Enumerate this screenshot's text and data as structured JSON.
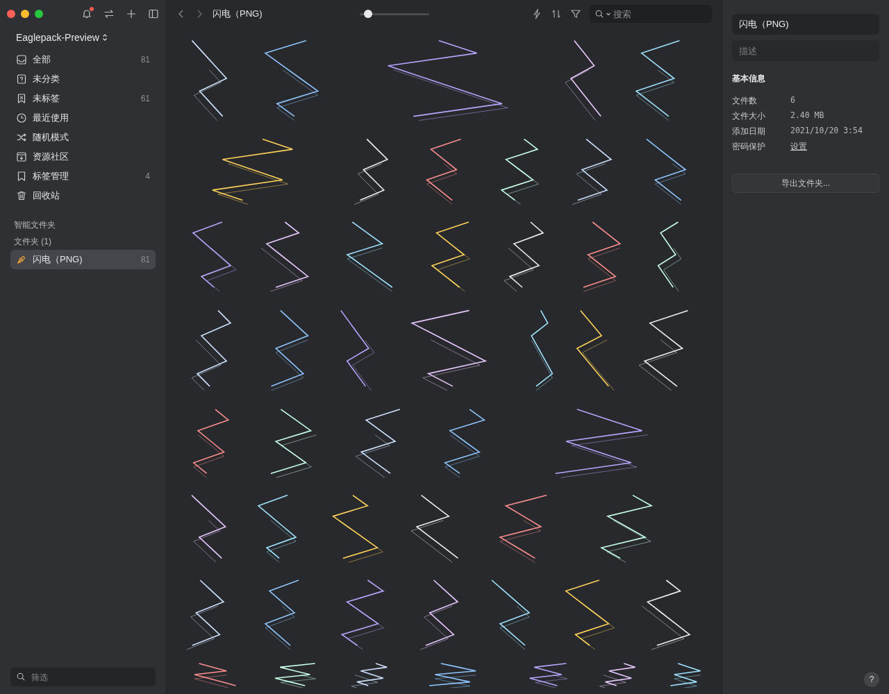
{
  "sidebar": {
    "library": "Eaglepack-Preview",
    "items": [
      {
        "kind": "inbox",
        "label": "全部",
        "count": "81",
        "selected": false
      },
      {
        "kind": "question",
        "label": "未分类",
        "selected": false
      },
      {
        "kind": "untagged",
        "label": "未标签",
        "count": "61",
        "selected": false
      },
      {
        "kind": "clock",
        "label": "最近使用",
        "selected": false
      },
      {
        "kind": "shuffle",
        "label": "随机模式",
        "selected": false
      },
      {
        "kind": "archive",
        "label": "资源社区",
        "selected": false
      },
      {
        "kind": "bookmark",
        "label": "标签管理",
        "count": "4",
        "selected": false
      },
      {
        "kind": "trash",
        "label": "回收站",
        "selected": false
      }
    ],
    "smart_folders": "智能文件夹",
    "folders_heading": "文件夹 (1)",
    "folders": [
      {
        "label": "闪电（PNG)",
        "count": "81",
        "selected": true
      }
    ],
    "filter": {
      "placeholder": "筛选"
    }
  },
  "toolbar": {
    "title": "闪电（PNG)",
    "zoom": {
      "level": 0.12
    },
    "search": {
      "placeholder": "搜索"
    },
    "notification_badge": true
  },
  "inspector": {
    "name": "闪电（PNG)",
    "description": {
      "placeholder": "描述"
    },
    "heading": "基本信息",
    "rows": [
      {
        "kind": "text",
        "label": "文件数",
        "value": "6"
      },
      {
        "kind": "text",
        "label": "文件大小",
        "value": "2.40 MB"
      },
      {
        "kind": "text",
        "label": "添加日期",
        "value": "2021/10/20 3:54"
      },
      {
        "kind": "link",
        "label": "密码保护",
        "value": "设置"
      }
    ],
    "button": "导出文件夹..."
  },
  "help": "?"
}
